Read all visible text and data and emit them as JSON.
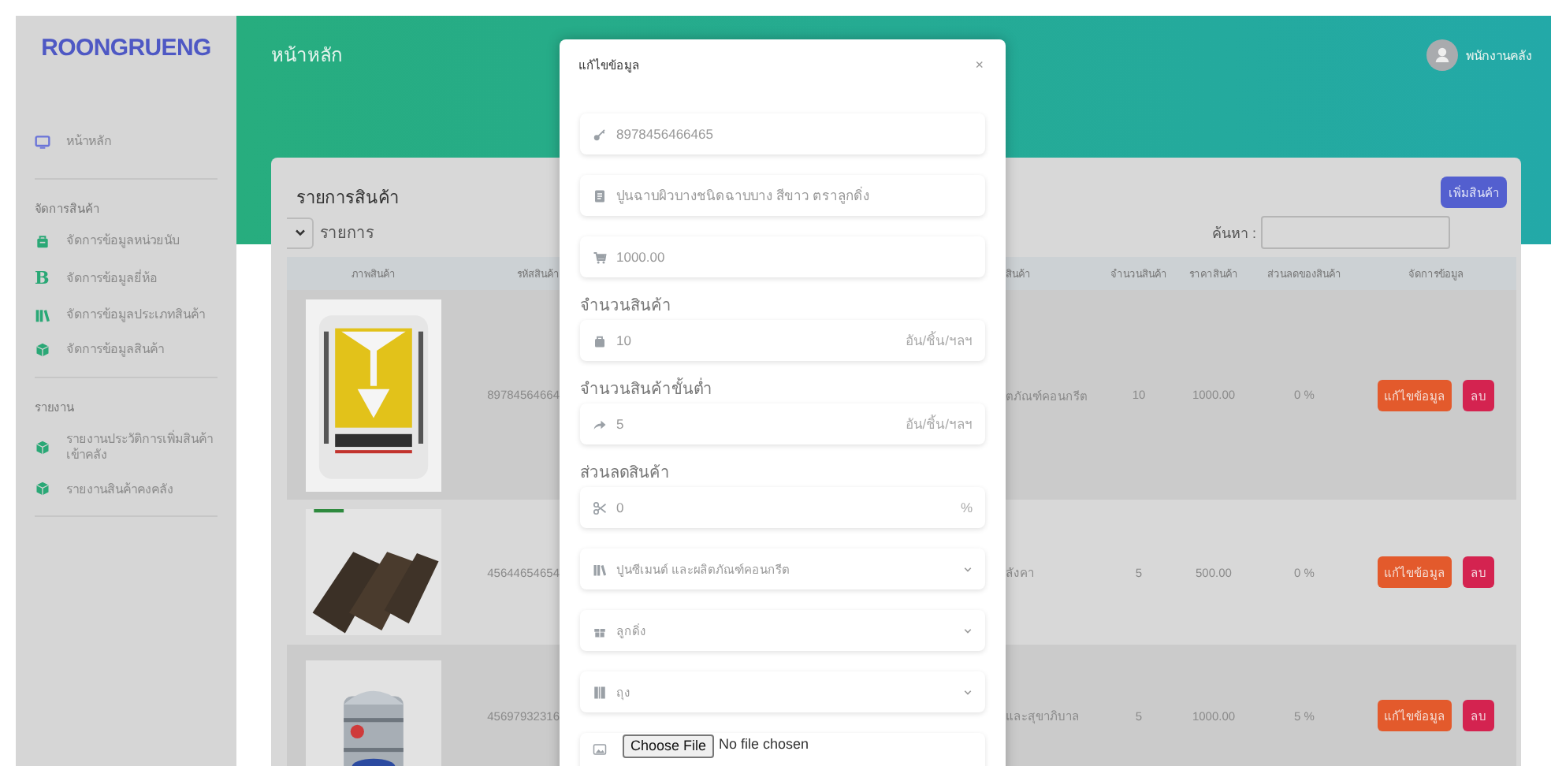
{
  "sidebar": {
    "logo": "ROONGRUENG",
    "home": {
      "label": "หน้าหลัก"
    },
    "sections": [
      {
        "title": "จัดการสินค้า",
        "items": [
          {
            "label": "จัดการข้อมูลหน่วยนับ"
          },
          {
            "label": "จัดการข้อมูลยี่ห้อ",
            "glyph": "B"
          },
          {
            "label": "จัดการข้อมูลประเภทสินค้า"
          },
          {
            "label": "จัดการข้อมูลสินค้า"
          }
        ]
      },
      {
        "title": "รายงาน",
        "items": [
          {
            "label": "รายงานประวัติการเพิ่มสินค้าเข้าคลัง"
          },
          {
            "label": "รายงานสินค้าคงคลัง"
          }
        ]
      }
    ]
  },
  "header": {
    "title": "หน้าหลัก",
    "user": "พนักงานคลัง"
  },
  "card": {
    "title": "รายการสินค้า",
    "add_button": "เพิ่มสินค้า",
    "page_size_label": "รายการ",
    "search_label": "ค้นหา :"
  },
  "table": {
    "columns": [
      "ภาพสินค้า",
      "รหัสสินค้า",
      "สินค้า",
      "จำนวนสินค้า",
      "ราคาสินค้า",
      "ส่วนลดของสินค้า",
      "จัดการข้อมูล"
    ],
    "rows": [
      {
        "code": "89784564664",
        "column_3": "ตภัณฑ์คอนกรีต",
        "qty": "10",
        "price": "1000.00",
        "discount": "0 %",
        "edit": "แก้ไขข้อมูล",
        "delete": "ลบ"
      },
      {
        "code": "45644654654",
        "column_3": "ลังคา",
        "qty": "5",
        "price": "500.00",
        "discount": "0 %",
        "edit": "แก้ไขข้อมูล",
        "delete": "ลบ"
      },
      {
        "code": "45697932316",
        "column_3": "และสุขาภิบาล",
        "qty": "5",
        "price": "1000.00",
        "discount": "5 %",
        "edit": "แก้ไขข้อมูล",
        "delete": "ลบ"
      }
    ]
  },
  "modal": {
    "title": "แก้ไขข้อมูล",
    "close": "×",
    "fields": [
      {
        "kind": "input",
        "value": "8978456466465"
      },
      {
        "kind": "input",
        "value": "ปูนฉาบผิวบางชนิดฉาบบาง สีขาว ตราลูกดิ่ง"
      },
      {
        "kind": "input",
        "value": "1000.00"
      },
      {
        "kind": "input",
        "label": "จำนวนสินค้า",
        "value": "10",
        "suffix": "อัน/ชิ้น/ฯลฯ"
      },
      {
        "kind": "input",
        "label": "จำนวนสินค้าขั้นต่ำ",
        "value": "5",
        "suffix": "อัน/ชิ้น/ฯลฯ"
      },
      {
        "kind": "input",
        "label": "ส่วนลดสินค้า",
        "value": "0",
        "suffix": "%"
      },
      {
        "kind": "select",
        "value": "ปูนซีเมนต์ และผลิตภัณฑ์คอนกรีต"
      },
      {
        "kind": "select",
        "value": "ลูกดิ่ง"
      },
      {
        "kind": "select",
        "value": "ถุง"
      },
      {
        "kind": "file",
        "button": "Choose File",
        "value": "No file chosen"
      }
    ]
  }
}
